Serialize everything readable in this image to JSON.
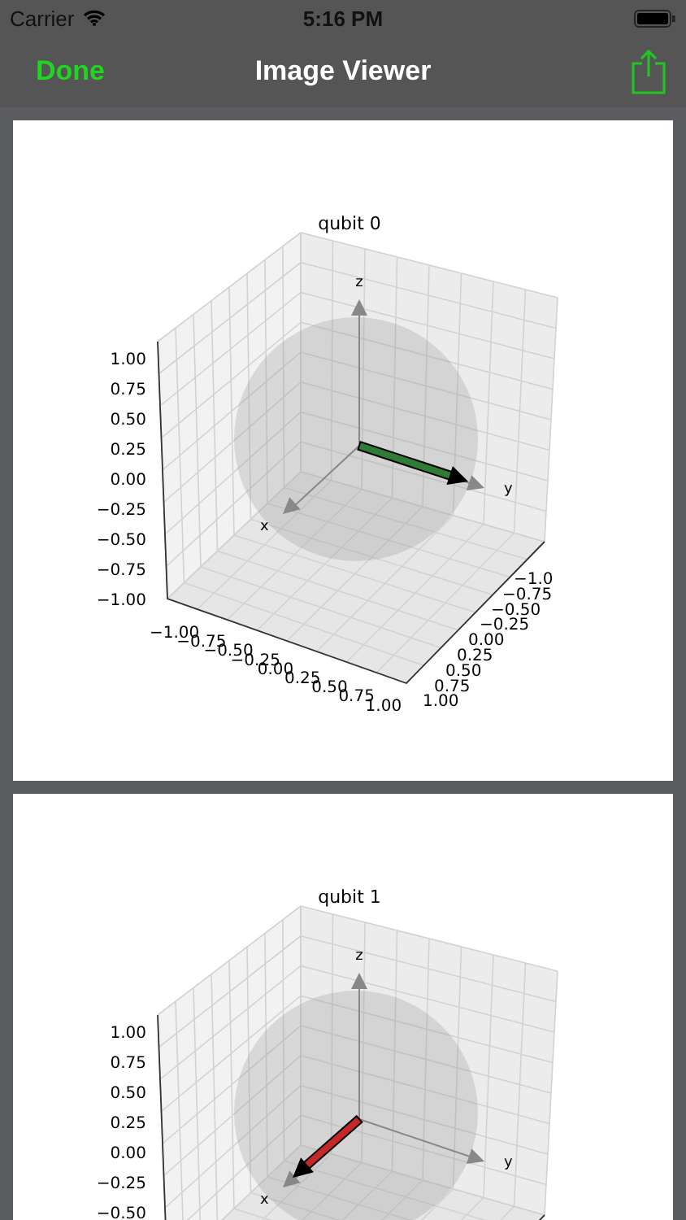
{
  "status_bar": {
    "carrier": "Carrier",
    "time": "5:16 PM"
  },
  "nav": {
    "done": "Done",
    "title": "Image Viewer"
  },
  "images": [
    {
      "title": "qubit 0",
      "axis_labels": {
        "x": "x",
        "y": "y",
        "z": "z"
      },
      "vector": {
        "kind": "along-y",
        "color": "#2e7d32"
      },
      "z_ticks": [
        "1.00",
        "0.75",
        "0.50",
        "0.25",
        "0.00",
        "−0.25",
        "−0.50",
        "−0.75",
        "−1.00"
      ],
      "x_ticks": [
        "−1.00",
        "−0.75",
        "−0.50",
        "−0.25",
        "0.00",
        "0.25",
        "0.50",
        "0.75",
        "1.00"
      ],
      "y_ticks": [
        "−1.0",
        "−0.75",
        "−0.50",
        "−0.25",
        "0.00",
        "0.25",
        "0.50",
        "0.75",
        "1.00"
      ]
    },
    {
      "title": "qubit 1",
      "axis_labels": {
        "x": "x",
        "y": "y",
        "z": "z"
      },
      "vector": {
        "kind": "along-x",
        "color": "#c62828"
      },
      "z_ticks": [
        "1.00",
        "0.75",
        "0.50",
        "0.25",
        "0.00",
        "−0.25",
        "−0.50"
      ]
    }
  ]
}
